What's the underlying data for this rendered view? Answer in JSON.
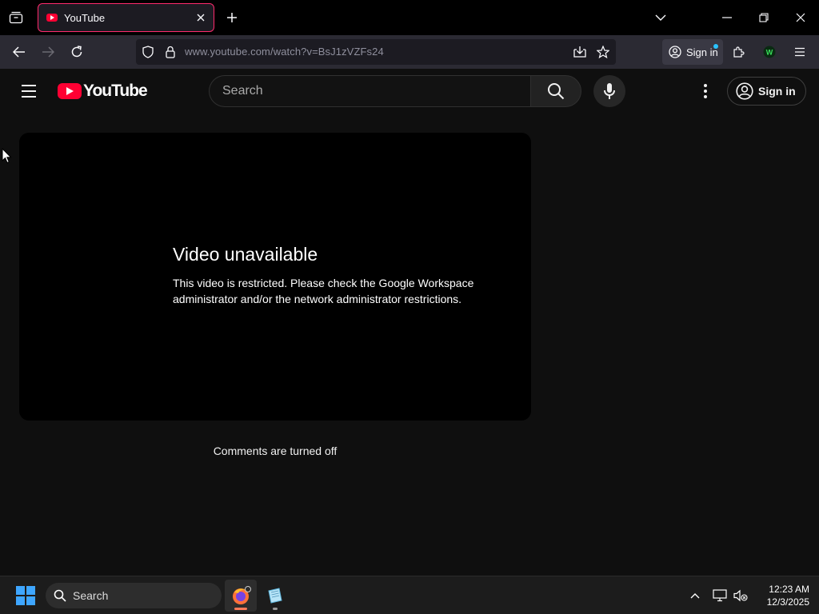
{
  "browser": {
    "tab": {
      "title": "YouTube"
    },
    "url": "www.youtube.com/watch?v=BsJ1zVZFs24",
    "signin_label": "Sign in"
  },
  "youtube": {
    "logo_text": "YouTube",
    "search_placeholder": "Search",
    "signin_label": "Sign in"
  },
  "player": {
    "error_title": "Video unavailable",
    "error_message": "This video is restricted. Please check the Google Workspace administrator and/or the network administrator restrictions."
  },
  "comments_status": "Comments are turned off",
  "taskbar": {
    "search_label": "Search",
    "time": "12:23 AM",
    "date": "12/3/2025"
  },
  "colors": {
    "tab_border": "#ff2a6d",
    "youtube_red": "#ff0033",
    "page_background": "#0f0f0f",
    "windows_accent": "#3ea6ff"
  }
}
